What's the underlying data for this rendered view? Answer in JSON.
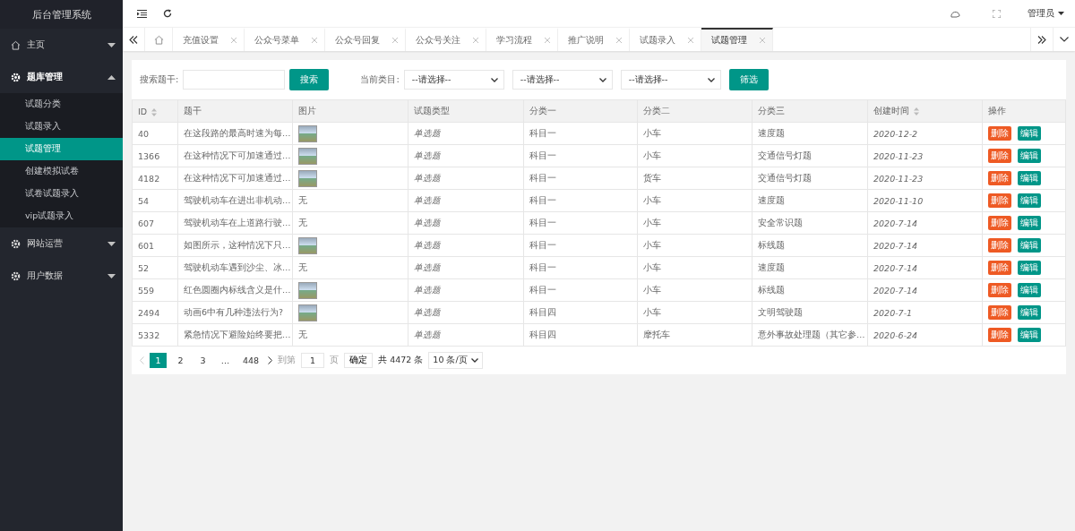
{
  "app_title": "后台管理系统",
  "sidebar": {
    "items": [
      {
        "label": "主页",
        "expanded": false
      },
      {
        "label": "题库管理",
        "expanded": true,
        "children": [
          {
            "label": "试题分类",
            "selected": false
          },
          {
            "label": "试题录入",
            "selected": false
          },
          {
            "label": "试题管理",
            "selected": true
          },
          {
            "label": "创建模拟试卷",
            "selected": false
          },
          {
            "label": "试卷试题录入",
            "selected": false
          },
          {
            "label": "vip试题录入",
            "selected": false
          }
        ]
      },
      {
        "label": "网站运营",
        "expanded": false
      },
      {
        "label": "用户数据",
        "expanded": false
      }
    ]
  },
  "header": {
    "user": "管理员"
  },
  "tabs": [
    {
      "label": "充值设置",
      "selected": false
    },
    {
      "label": "公众号菜单",
      "selected": false
    },
    {
      "label": "公众号回复",
      "selected": false
    },
    {
      "label": "公众号关注",
      "selected": false
    },
    {
      "label": "学习流程",
      "selected": false
    },
    {
      "label": "推广说明",
      "selected": false
    },
    {
      "label": "试题录入",
      "selected": false
    },
    {
      "label": "试题管理",
      "selected": true
    }
  ],
  "filter": {
    "search_label": "搜索题干:",
    "search_button": "搜索",
    "category_label": "当前类目:",
    "selects": [
      "--请选择--",
      "--请选择--",
      "--请选择--"
    ],
    "filter_button": "筛选"
  },
  "table": {
    "columns": [
      {
        "label": "ID",
        "sortable": true
      },
      {
        "label": "题干",
        "sortable": false
      },
      {
        "label": "图片",
        "sortable": false
      },
      {
        "label": "试题类型",
        "sortable": false
      },
      {
        "label": "分类一",
        "sortable": false
      },
      {
        "label": "分类二",
        "sortable": false
      },
      {
        "label": "分类三",
        "sortable": false
      },
      {
        "label": "创建时间",
        "sortable": true
      },
      {
        "label": "操作",
        "sortable": false
      }
    ],
    "rows": [
      {
        "id": "40",
        "stem": "在这段路的最高时速为每…",
        "picture": {
          "kind": "photo"
        },
        "type": "单选题",
        "cat1": "科目一",
        "cat2": "小车",
        "cat3": "速度题",
        "created": "2020-12-2",
        "actions": [
          "删除",
          "编辑"
        ]
      },
      {
        "id": "1366",
        "stem": "在这种情况下可加速通过…",
        "picture": {
          "kind": "photo"
        },
        "type": "单选题",
        "cat1": "科目一",
        "cat2": "小车",
        "cat3": "交通信号灯题",
        "created": "2020-11-23",
        "actions": [
          "删除",
          "编辑"
        ]
      },
      {
        "id": "4182",
        "stem": "在这种情况下可加速通过…",
        "picture": {
          "kind": "photo"
        },
        "type": "单选题",
        "cat1": "科目一",
        "cat2": "货车",
        "cat3": "交通信号灯题",
        "created": "2020-11-23",
        "actions": [
          "删除",
          "编辑"
        ]
      },
      {
        "id": "54",
        "stem": "驾驶机动车在进出非机动…",
        "picture": {
          "kind": "text",
          "text": "无"
        },
        "type": "单选题",
        "cat1": "科目一",
        "cat2": "小车",
        "cat3": "速度题",
        "created": "2020-11-10",
        "actions": [
          "删除",
          "编辑"
        ]
      },
      {
        "id": "607",
        "stem": "驾驶机动车在上道路行驶…",
        "picture": {
          "kind": "text",
          "text": "无"
        },
        "type": "单选题",
        "cat1": "科目一",
        "cat2": "小车",
        "cat3": "安全常识题",
        "created": "2020-7-14",
        "actions": [
          "删除",
          "编辑"
        ]
      },
      {
        "id": "601",
        "stem": "如图所示，这种情况下只…",
        "picture": {
          "kind": "photo"
        },
        "type": "单选题",
        "cat1": "科目一",
        "cat2": "小车",
        "cat3": "标线题",
        "created": "2020-7-14",
        "actions": [
          "删除",
          "编辑"
        ]
      },
      {
        "id": "52",
        "stem": "驾驶机动车遇到沙尘、冰…",
        "picture": {
          "kind": "text",
          "text": "无"
        },
        "type": "单选题",
        "cat1": "科目一",
        "cat2": "小车",
        "cat3": "速度题",
        "created": "2020-7-14",
        "actions": [
          "删除",
          "编辑"
        ]
      },
      {
        "id": "559",
        "stem": "红色圆圈内标线含义是什…",
        "picture": {
          "kind": "photo"
        },
        "type": "单选题",
        "cat1": "科目一",
        "cat2": "小车",
        "cat3": "标线题",
        "created": "2020-7-14",
        "actions": [
          "删除",
          "编辑"
        ]
      },
      {
        "id": "2494",
        "stem": "动画6中有几种违法行为?",
        "picture": {
          "kind": "photo"
        },
        "type": "单选题",
        "cat1": "科目四",
        "cat2": "小车",
        "cat3": "文明驾驶题",
        "created": "2020-7-1",
        "actions": [
          "删除",
          "编辑"
        ]
      },
      {
        "id": "5332",
        "stem": "紧急情况下避险始终要把…",
        "picture": {
          "kind": "text",
          "text": "无"
        },
        "type": "单选题",
        "cat1": "科目四",
        "cat2": "摩托车",
        "cat3": "意外事故处理题（其它参…",
        "created": "2020-6-24",
        "actions": [
          "删除",
          "编辑"
        ]
      }
    ]
  },
  "pagination": {
    "pages": [
      {
        "label": "1",
        "selected": true
      },
      {
        "label": "2",
        "selected": false
      },
      {
        "label": "3",
        "selected": false
      },
      {
        "label": "…",
        "selected": false
      },
      {
        "label": "448",
        "selected": false
      }
    ],
    "goto_label": "到第",
    "goto_value": "1",
    "page_unit": "页",
    "confirm": "确定",
    "total": "共 4472 条",
    "page_size": "10 条/页"
  }
}
